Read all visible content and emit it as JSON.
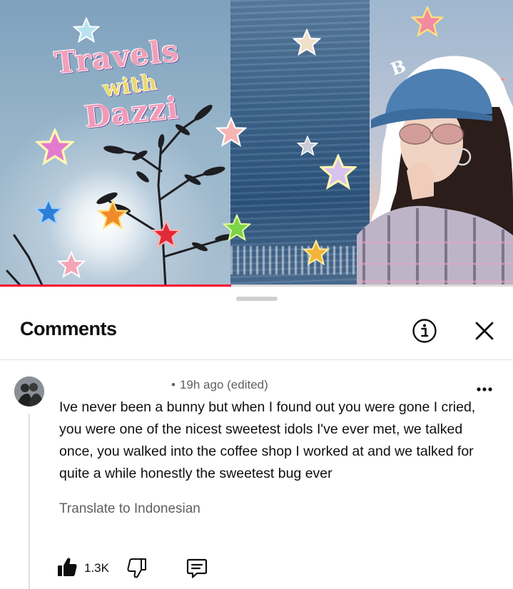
{
  "thumbnail": {
    "title_lines": [
      "Travels",
      "with",
      "Dazzi"
    ],
    "cap_letter": "B",
    "progress_fraction": 0.45
  },
  "sheet": {
    "title": "Comments"
  },
  "comment": {
    "timestamp": "19h ago (edited)",
    "dot": "•",
    "text": "Ive never been a bunny but when I  found out you were gone I cried, you were one of the nicest sweetest idols I've ever met, we talked once, you walked into the coffee shop I worked at and we talked for quite a while honestly the sweetest bug ever",
    "translate_label": "Translate to Indonesian",
    "like_count": "1.3K"
  },
  "icons": {
    "info": "info-icon",
    "close": "close-icon",
    "more": "more-vert-icon",
    "like": "thumbs-up-icon",
    "dislike": "thumbs-down-icon",
    "reply": "reply-comment-icon"
  },
  "colors": {
    "accent": "#ff0033",
    "text_primary": "#0f0f0f",
    "text_secondary": "#606060"
  }
}
